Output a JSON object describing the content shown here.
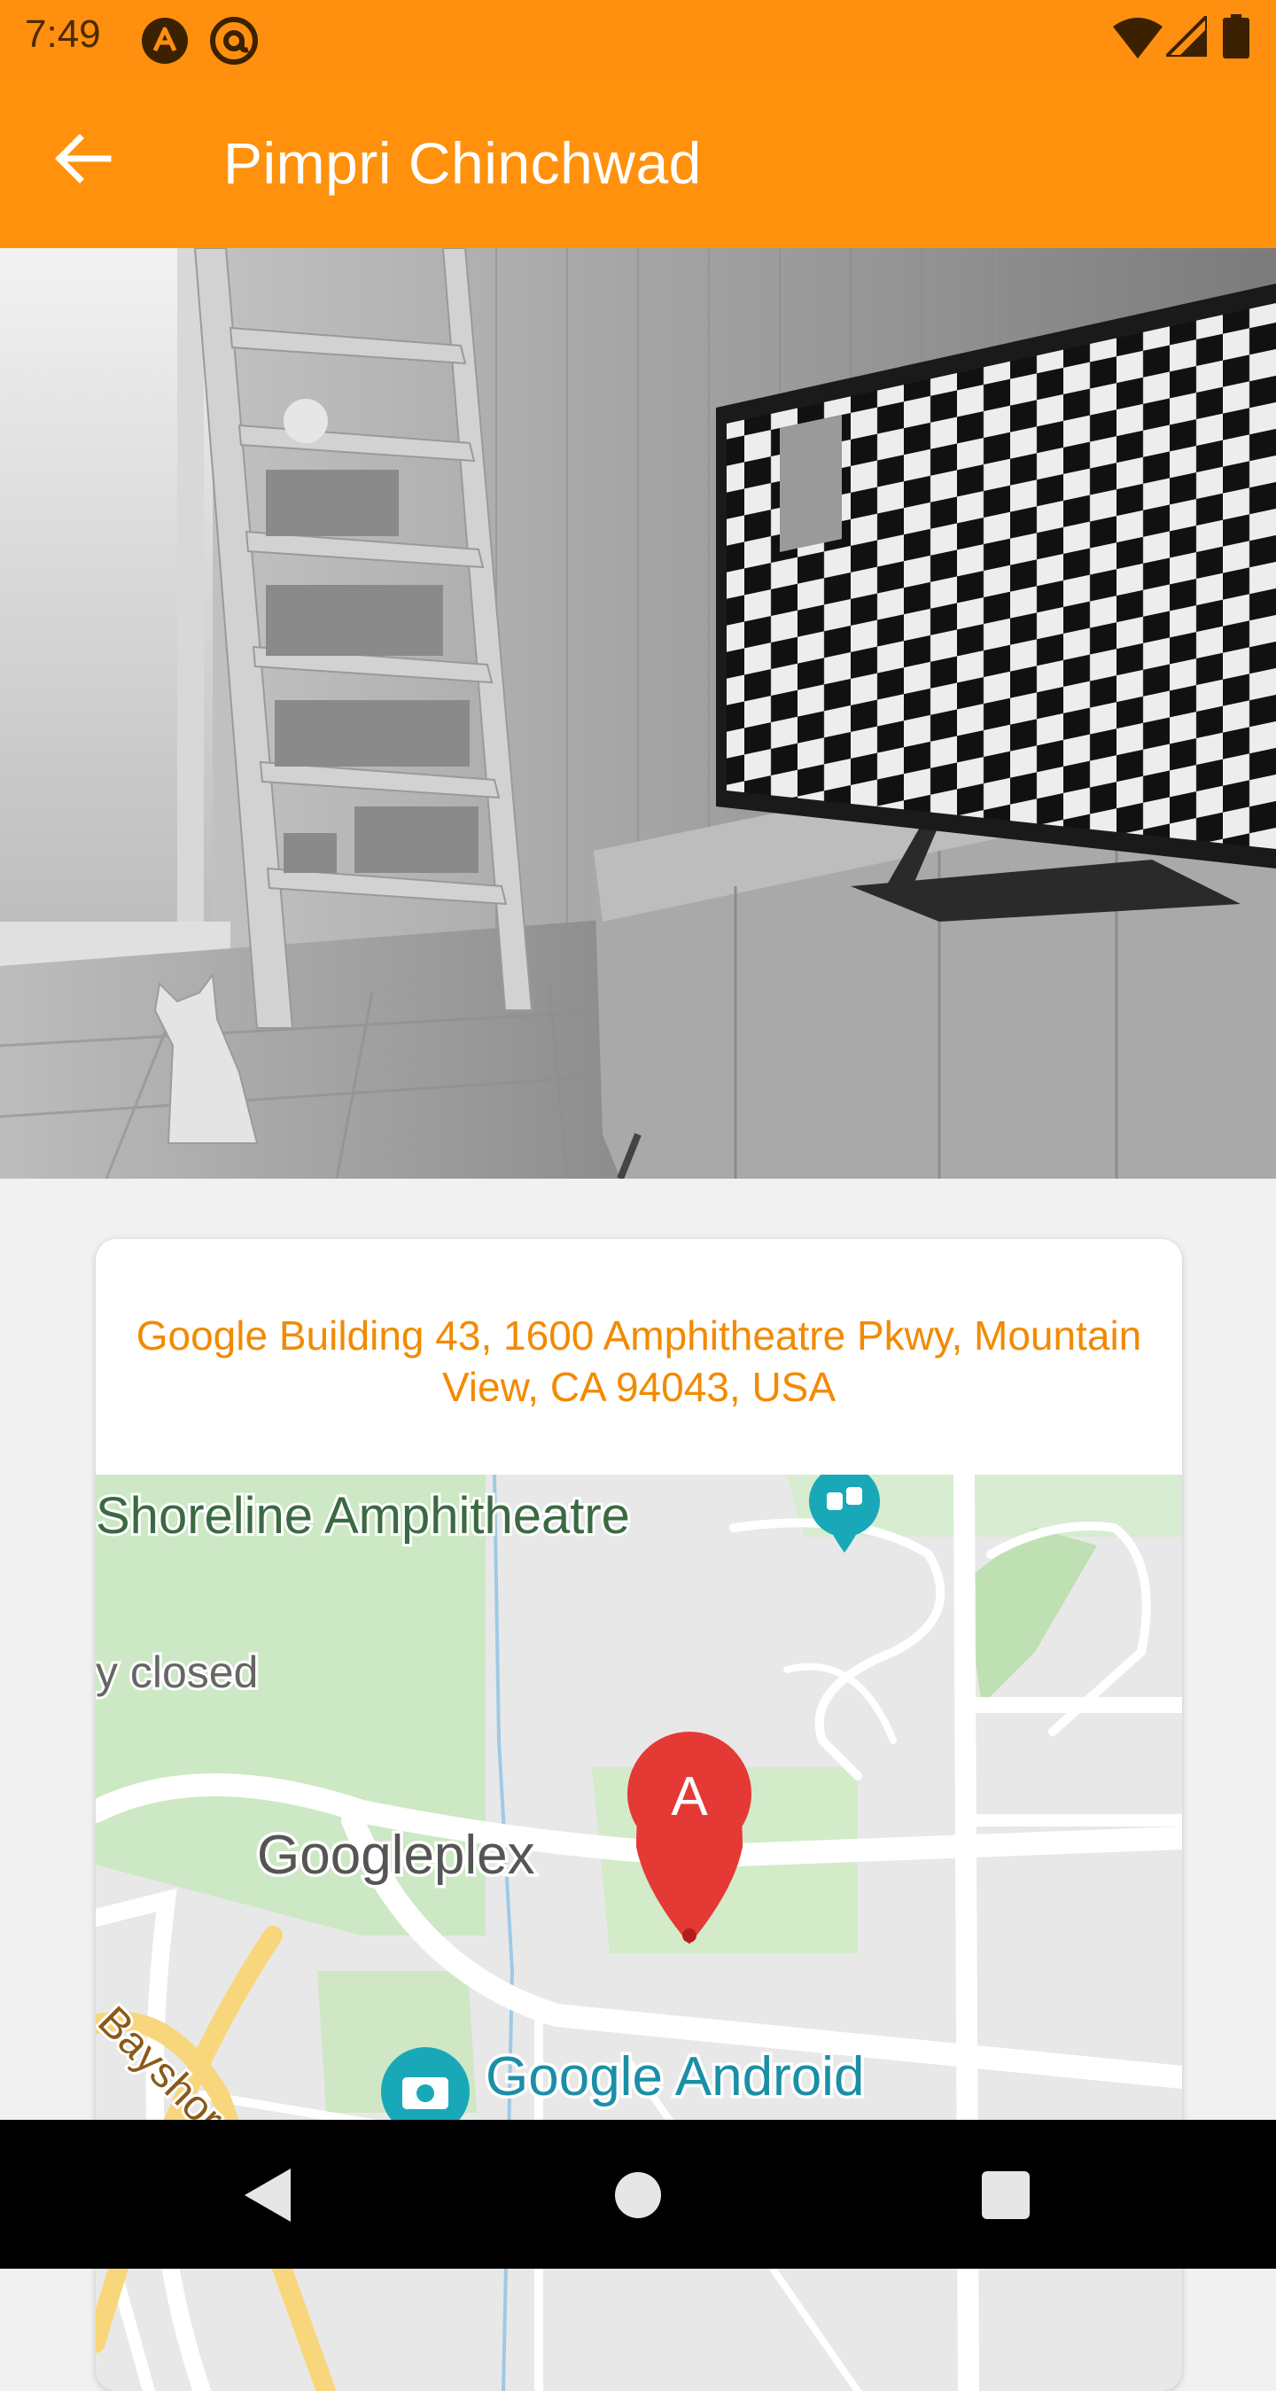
{
  "status_bar": {
    "time": "7:49",
    "icons": [
      "notification-a-icon",
      "notification-at-icon",
      "wifi-icon",
      "signal-icon",
      "battery-icon"
    ]
  },
  "app_bar": {
    "title": "Pimpri Chinchwad",
    "back_icon": "arrow-back-icon"
  },
  "hero": {
    "description_icon": "room-photo"
  },
  "card": {
    "address": "Google Building 43, 1600 Amphitheatre Pkwy, Mountain View, CA 94043, USA"
  },
  "map": {
    "labels": {
      "shoreline": "Shoreline Amphitheatre",
      "closed": "y closed",
      "googleplex": "Googleplex",
      "bayshore": "Bayshore Fwy",
      "android": "Google Android"
    },
    "marker_label": "A"
  },
  "nav_bar": {
    "back_icon": "nav-back-icon",
    "home_icon": "nav-home-icon",
    "recents_icon": "nav-recents-icon"
  },
  "colors": {
    "accent": "#FF910D",
    "address_text": "#F28A00",
    "marker": "#E53935"
  }
}
